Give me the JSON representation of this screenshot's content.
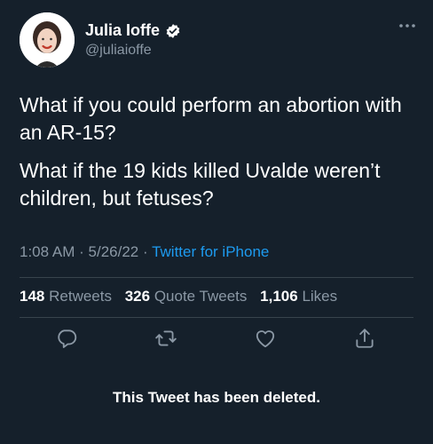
{
  "author": {
    "name": "Julia Ioffe",
    "handle": "@juliaioffe",
    "verified": true
  },
  "tweet": {
    "paragraphs": [
      "What if you could perform an abortion with an AR-15?",
      "What if the 19 kids killed Uvalde weren’t children, but fetuses?"
    ],
    "time": "1:08 AM",
    "date": "5/26/22",
    "separator": "·",
    "source": "Twitter for iPhone"
  },
  "stats": {
    "retweets_count": "148",
    "retweets_label": "Retweets",
    "quotes_count": "326",
    "quotes_label": "Quote Tweets",
    "likes_count": "1,106",
    "likes_label": "Likes"
  },
  "actions": {
    "reply_icon": "reply-icon",
    "retweet_icon": "retweet-icon",
    "like_icon": "heart-icon",
    "share_icon": "share-icon"
  },
  "notice": "This Tweet has been deleted.",
  "colors": {
    "background": "#15202b",
    "text": "#ffffff",
    "secondary": "#8b98a5",
    "accent": "#1d9bf0",
    "divider": "#38444d"
  }
}
